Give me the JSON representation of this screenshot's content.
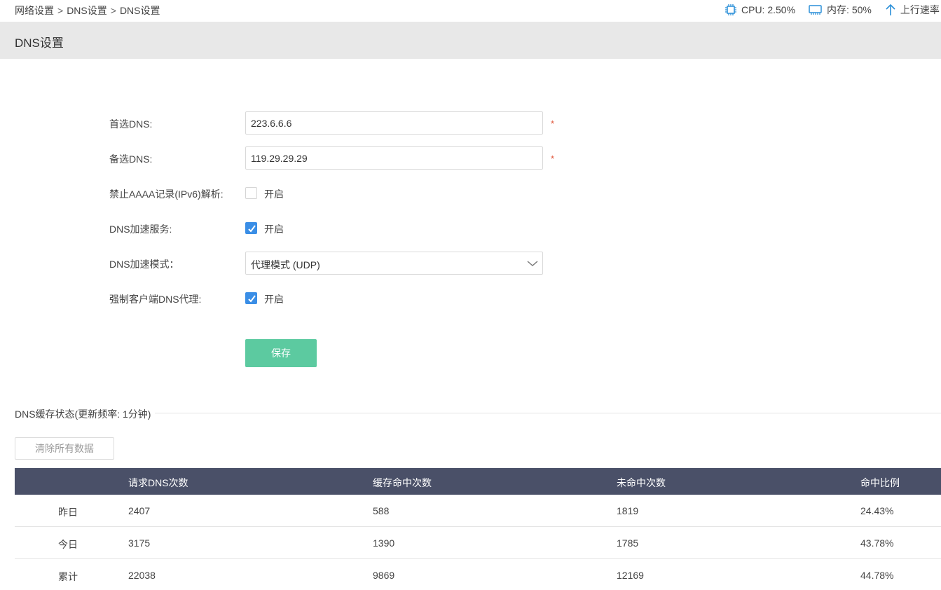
{
  "breadcrumb": [
    "网络设置",
    "DNS设置",
    "DNS设置"
  ],
  "breadcrumb_separator": ">",
  "stats": {
    "cpu": "CPU: 2.50%",
    "memory": "内存: 50%",
    "upload": "上行速率"
  },
  "page_title": "DNS设置",
  "form": {
    "primary_dns": {
      "label": "首选DNS:",
      "value": "223.6.6.6",
      "required_mark": "*"
    },
    "secondary_dns": {
      "label": "备选DNS:",
      "value": "119.29.29.29",
      "required_mark": "*"
    },
    "block_aaaa": {
      "label": "禁止AAAA记录(IPv6)解析:",
      "option_label": "开启",
      "checked": false
    },
    "dns_acceleration": {
      "label": "DNS加速服务:",
      "option_label": "开启",
      "checked": true
    },
    "acceleration_mode": {
      "label": "DNS加速模式：",
      "selected": "代理模式 (UDP)"
    },
    "force_client_proxy": {
      "label": "强制客户端DNS代理:",
      "option_label": "开启",
      "checked": true
    },
    "save_label": "保存"
  },
  "cache": {
    "section_title": "DNS缓存状态(更新频率: 1分钟)",
    "clear_label": "清除所有数据",
    "columns": [
      "",
      "请求DNS次数",
      "缓存命中次数",
      "未命中次数",
      "命中比例"
    ],
    "rows": [
      [
        "昨日",
        "2407",
        "588",
        "1819",
        "24.43%"
      ],
      [
        "今日",
        "3175",
        "1390",
        "1785",
        "43.78%"
      ],
      [
        "累计",
        "22038",
        "9869",
        "12169",
        "44.78%"
      ]
    ]
  },
  "colors": {
    "header_bar": "#e8e8e8",
    "table_header": "#4a5068",
    "save_button": "#5ccaa0",
    "checkbox_checked": "#3a8ee6",
    "required": "#e0553a",
    "icon_blue": "#2a8fd8"
  }
}
